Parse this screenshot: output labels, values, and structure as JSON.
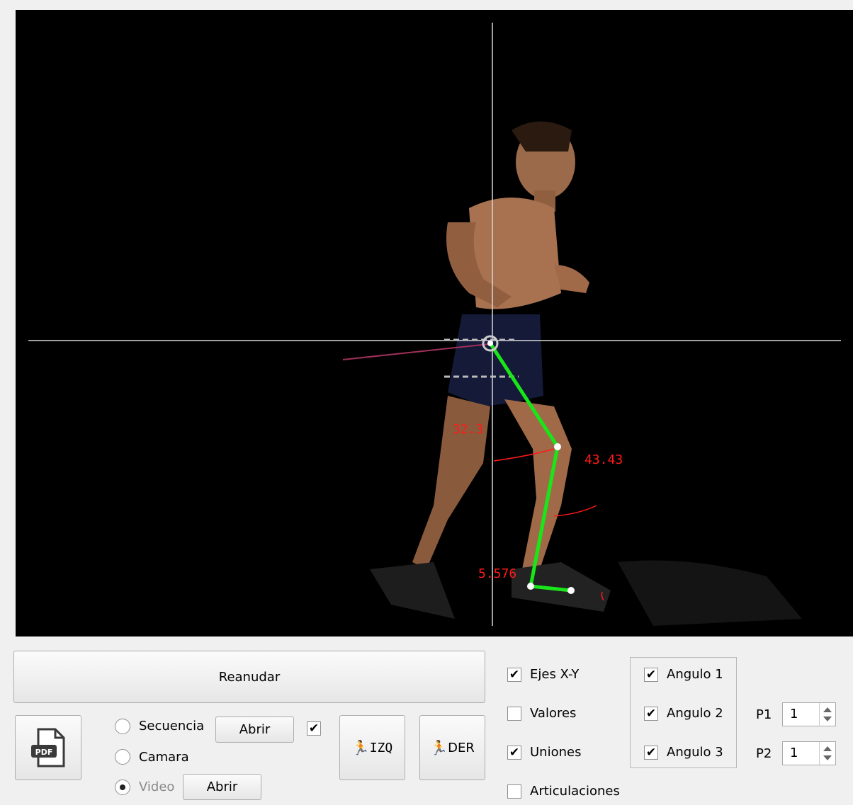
{
  "video": {
    "angles": {
      "angle1": "32.3",
      "angle2": "43.43",
      "angle3": "5.576"
    }
  },
  "controls": {
    "resume_label": "Reanudar",
    "pdf_icon_text": "PDF",
    "radio_secuencia": "Secuencia",
    "radio_camara": "Camara",
    "radio_video": "Video",
    "selected_source": "Video",
    "open_label_1": "Abrir",
    "open_label_2": "Abrir",
    "izq_label": "IZQ",
    "der_label": "DER",
    "check_ejes": "Ejes X-Y",
    "check_valores": "Valores",
    "check_uniones": "Uniones",
    "check_articulaciones": "Articulaciones",
    "check_angulo1": "Angulo 1",
    "check_angulo2": "Angulo 2",
    "check_angulo3": "Angulo 3",
    "p1_label": "P1",
    "p1_value": "1",
    "p2_label": "P2",
    "p2_value": "1",
    "checked": {
      "abrir_toggle": true,
      "ejes": true,
      "valores": false,
      "uniones": true,
      "articulaciones": false,
      "angulo1": true,
      "angulo2": true,
      "angulo3": true
    }
  }
}
